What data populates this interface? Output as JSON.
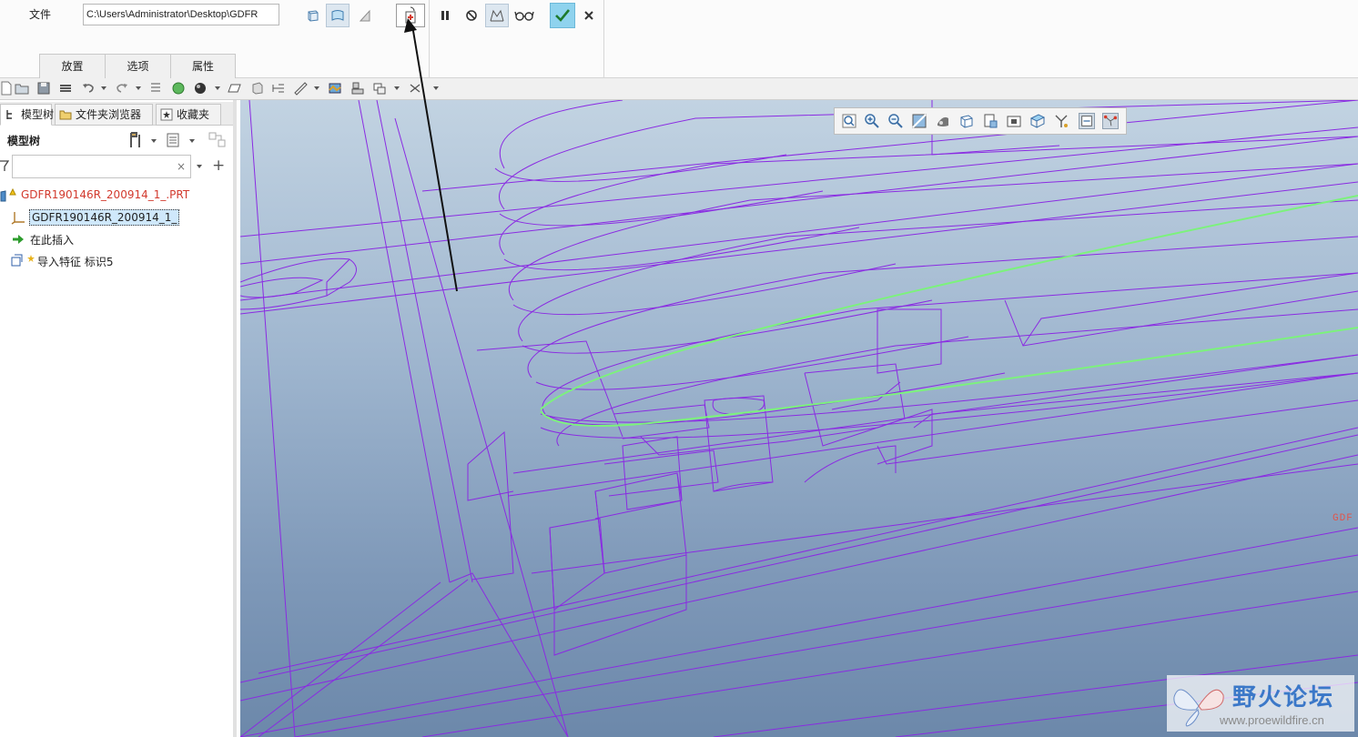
{
  "dashboard": {
    "file_label": "文件",
    "file_path": "C:\\Users\\Administrator\\Desktop\\GDFR",
    "tabs": [
      "放置",
      "选项",
      "属性"
    ]
  },
  "navigator": {
    "tabs": [
      "模型树",
      "文件夹浏览器",
      "收藏夹"
    ],
    "title": "模型树",
    "search_value": "",
    "clear_glyph": "×",
    "add_glyph": "+",
    "tree": [
      {
        "label": "GDFR190146R_200914_1_.PRT",
        "icon": "part-icon"
      },
      {
        "label": "GDFR190146R_200914_1_",
        "icon": "csys-icon",
        "selected": true
      },
      {
        "label": "在此插入",
        "icon": "insert-here-arrow-icon"
      },
      {
        "label": "导入特征 标识5",
        "icon": "import-feature-icon"
      }
    ]
  },
  "graphics": {
    "side_tag": "GDF"
  },
  "watermark": {
    "title": "野火论坛",
    "url": "www.proewildfire.cn"
  },
  "colors": {
    "wireframe": "#8a2be2",
    "highlight": "#7cf27c",
    "ok_button": "#8fd3ee",
    "tree_error_text": "#d23a2e"
  }
}
